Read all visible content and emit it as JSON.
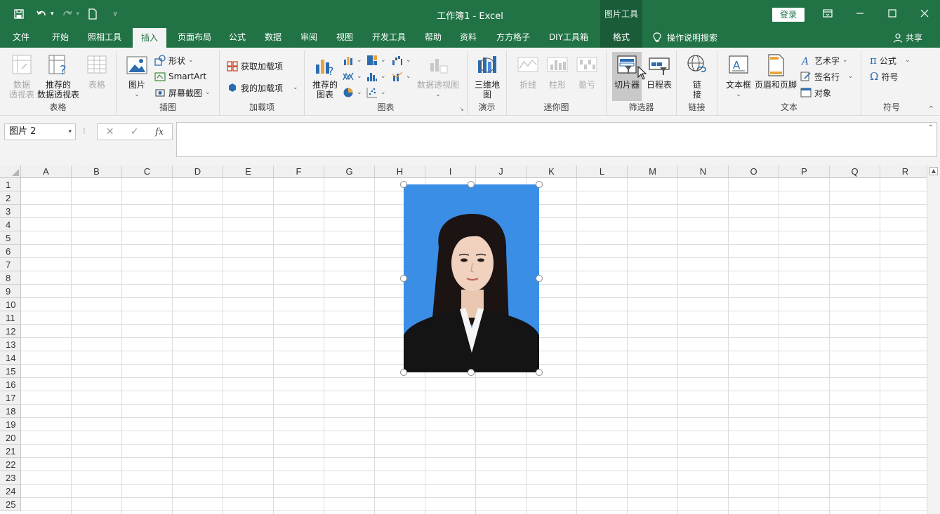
{
  "titlebar": {
    "document_title": "工作簿1  -  Excel",
    "context_tab_title": "图片工具",
    "login_label": "登录",
    "qat_icons": [
      "save-icon",
      "undo-icon",
      "redo-icon",
      "new-file-icon",
      "customize-icon"
    ]
  },
  "menu": {
    "tabs": [
      {
        "label": "文件"
      },
      {
        "label": "开始"
      },
      {
        "label": "照相工具"
      },
      {
        "label": "插入"
      },
      {
        "label": "页面布局"
      },
      {
        "label": "公式"
      },
      {
        "label": "数据"
      },
      {
        "label": "审阅"
      },
      {
        "label": "视图"
      },
      {
        "label": "开发工具"
      },
      {
        "label": "帮助"
      },
      {
        "label": "资料"
      },
      {
        "label": "方方格子"
      },
      {
        "label": "DIY工具箱"
      },
      {
        "label": "格式"
      }
    ],
    "active_tab": "插入",
    "search_hint": "操作说明搜索",
    "share_label": "共享"
  },
  "ribbon": {
    "groups": {
      "tables": {
        "label": "表格",
        "pivot": "数据\n透视表",
        "recommended_pivot": "推荐的\n数据透视表",
        "table": "表格"
      },
      "illustrations": {
        "label": "插图",
        "pictures": "图片",
        "shapes": "形状",
        "smartart": "SmartArt",
        "screenshot": "屏幕截图"
      },
      "addins": {
        "label": "加载项",
        "get_addins": "获取加载项",
        "my_addins": "我的加载项"
      },
      "charts": {
        "label": "图表",
        "recommended": "推荐的\n图表",
        "pivot_chart": "数据透视图"
      },
      "tours": {
        "label": "演示",
        "map3d": "三维地\n图"
      },
      "sparklines": {
        "label": "迷你图",
        "line": "折线",
        "column": "柱形",
        "winloss": "盈亏"
      },
      "filters": {
        "label": "筛选器",
        "slicer": "切片器",
        "timeline": "日程表"
      },
      "links": {
        "label": "链接",
        "link": "链\n接"
      },
      "text": {
        "label": "文本",
        "textbox": "文本框",
        "header_footer": "页眉和页脚",
        "wordart": "艺术字",
        "signature": "签名行",
        "object": "对象"
      },
      "symbols": {
        "label": "符号",
        "equation": "公式",
        "symbol": "符号"
      }
    }
  },
  "formula_bar": {
    "name_box": "图片 2",
    "cancel": "✕",
    "enter": "✓",
    "fx": "fx",
    "content": ""
  },
  "sheet": {
    "columns": [
      "A",
      "B",
      "C",
      "D",
      "E",
      "F",
      "G",
      "H",
      "I",
      "J",
      "K",
      "L",
      "M",
      "N",
      "O",
      "P",
      "Q",
      "R"
    ],
    "rows": [
      "1",
      "2",
      "3",
      "4",
      "5",
      "6",
      "7",
      "8",
      "9",
      "10",
      "11",
      "12",
      "13",
      "14",
      "15",
      "16",
      "17",
      "18",
      "19",
      "20",
      "21",
      "22",
      "23",
      "24",
      "25"
    ]
  },
  "colors": {
    "excel_green": "#217346",
    "context_green": "#1a5c38",
    "photo_background": "#3a8ee6"
  }
}
